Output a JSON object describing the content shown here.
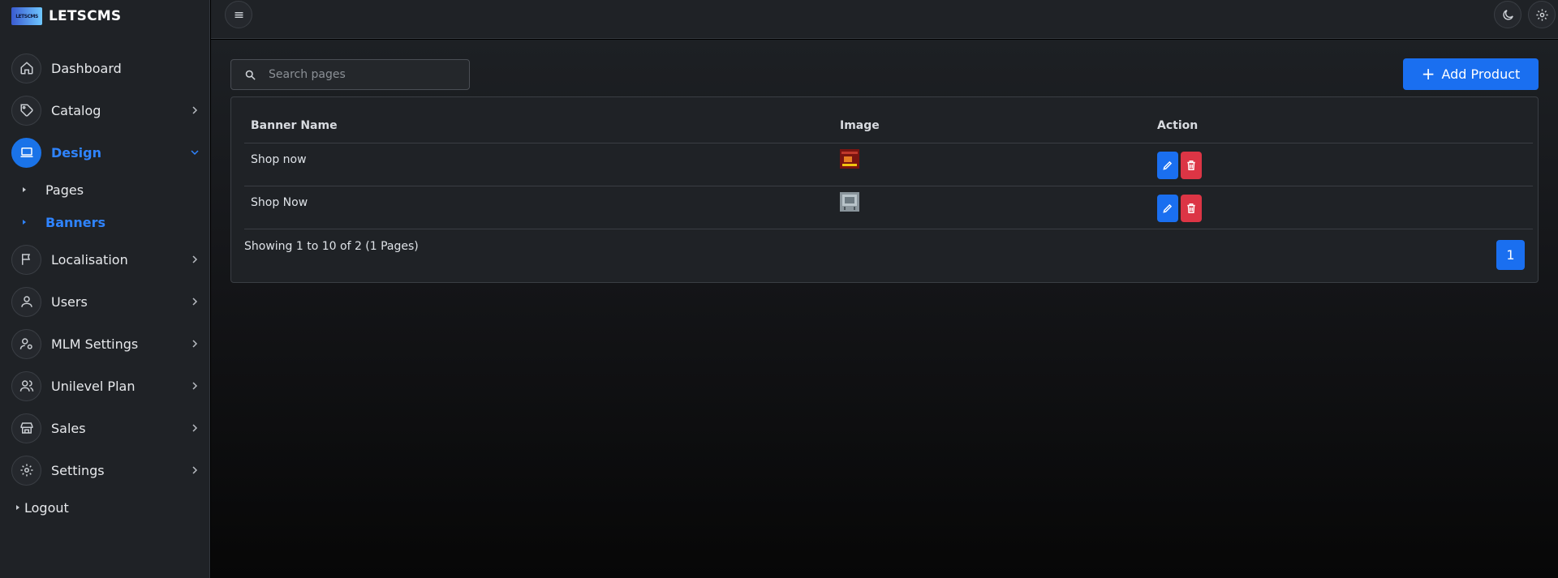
{
  "brand": {
    "logo_text": "LETSCMS",
    "name": "LETSCMS"
  },
  "sidebar": {
    "items": [
      {
        "label": "Dashboard",
        "icon": "home-icon"
      },
      {
        "label": "Catalog",
        "icon": "tag-icon"
      },
      {
        "label": "Design",
        "icon": "monitor-icon",
        "active": true
      },
      {
        "label": "Localisation",
        "icon": "flag-icon"
      },
      {
        "label": "Users",
        "icon": "user-icon"
      },
      {
        "label": "MLM Settings",
        "icon": "user-gear-icon"
      },
      {
        "label": "Unilevel Plan",
        "icon": "users-icon"
      },
      {
        "label": "Sales",
        "icon": "store-icon"
      },
      {
        "label": "Settings",
        "icon": "gear-icon"
      }
    ],
    "design_sub": [
      {
        "label": "Pages"
      },
      {
        "label": "Banners",
        "active": true
      }
    ],
    "logout": "Logout"
  },
  "topbar": {
    "menu_icon": "hamburger-icon",
    "theme_icon": "moon-icon",
    "settings_icon": "gear-icon"
  },
  "search": {
    "placeholder": "Search pages",
    "value": ""
  },
  "add_button": {
    "label": "Add Product"
  },
  "table": {
    "columns": [
      "Banner Name",
      "Image",
      "Action"
    ],
    "rows": [
      {
        "name": "Shop now",
        "image": "red banner thumbnail"
      },
      {
        "name": "Shop Now",
        "image": "grey banner thumbnail"
      }
    ]
  },
  "pagination": {
    "summary": "Showing 1 to 10 of 2 (1 Pages)",
    "current": "1"
  },
  "colors": {
    "accent": "#1a6ff0",
    "danger": "#dc3545",
    "sidebar_bg": "#1f2226"
  }
}
